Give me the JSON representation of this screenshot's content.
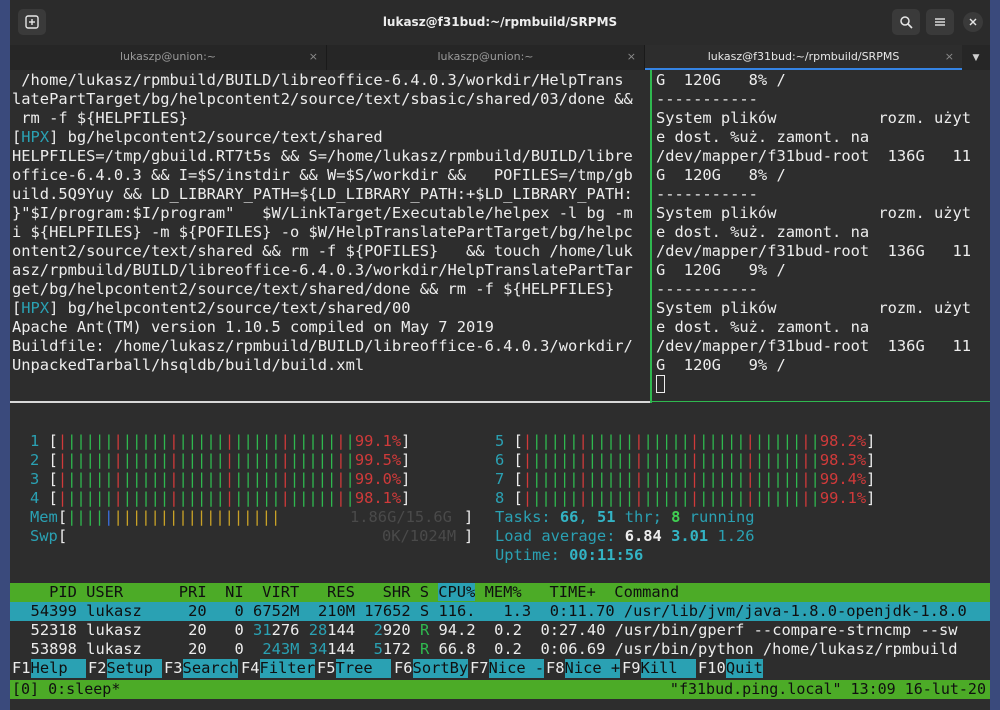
{
  "window": {
    "title": "lukasz@f31bud:~/rpmbuild/SRPMS",
    "new_tab_icon": "⊞",
    "search_icon": "🔍",
    "menu_icon": "≡",
    "close_icon": "✕"
  },
  "tabs": [
    {
      "label": "lukaszp@union:~",
      "close": "×"
    },
    {
      "label": "lukaszp@union:~",
      "close": "×"
    },
    {
      "label": "lukasz@f31bud:~/rpmbuild/SRPMS",
      "close": "×"
    }
  ],
  "tab_dropdown": "▼",
  "left_pane": {
    "l1": " /home/lukasz/rpmbuild/BUILD/libreoffice-6.4.0.3/workdir/HelpTrans",
    "l2": "latePartTarget/bg/helpcontent2/source/text/sbasic/shared/03/done &&",
    "l3": " rm -f ${HELPFILES}",
    "l4_tag": "HPX",
    "l4_rest": " bg/helpcontent2/source/text/shared",
    "l5": "HELPFILES=/tmp/gbuild.RT7t5s && S=/home/lukasz/rpmbuild/BUILD/libre",
    "l6": "office-6.4.0.3 && I=$S/instdir && W=$S/workdir &&   POFILES=/tmp/gb",
    "l7": "uild.5Q9Yuy && LD_LIBRARY_PATH=${LD_LIBRARY_PATH:+$LD_LIBRARY_PATH:",
    "l8": "}\"$I/program:$I/program\"   $W/LinkTarget/Executable/helpex -l bg -m",
    "l9": "i ${HELPFILES} -m ${POFILES} -o $W/HelpTranslatePartTarget/bg/helpc",
    "l10": "ontent2/source/text/shared && rm -f ${POFILES}   && touch /home/luk",
    "l11": "asz/rpmbuild/BUILD/libreoffice-6.4.0.3/workdir/HelpTranslatePartTar",
    "l12": "get/bg/helpcontent2/source/text/shared/done && rm -f ${HELPFILES}",
    "l13_tag": "HPX",
    "l13_rest": " bg/helpcontent2/source/text/shared/00",
    "l14": "Apache Ant(TM) version 1.10.5 compiled on May 7 2019",
    "l15": "Buildfile: /home/lukasz/rpmbuild/BUILD/libreoffice-6.4.0.3/workdir/",
    "l16": "UnpackedTarball/hsqldb/build/build.xml"
  },
  "right_pane": [
    "G  120G   8% /",
    "-----------",
    "System plików           rozm. użyt",
    "e dost. %uż. zamont. na",
    "/dev/mapper/f31bud-root  136G   11",
    "G  120G   8% /",
    "-----------",
    "System plików           rozm. użyt",
    "e dost. %uż. zamont. na",
    "/dev/mapper/f31bud-root  136G   11",
    "G  120G   9% /",
    "-----------",
    "System plików           rozm. użyt",
    "e dost. %uż. zamont. na",
    "/dev/mapper/f31bud-root  136G   11",
    "G  120G   9% /"
  ],
  "htop": {
    "cpus": [
      {
        "id": "1",
        "pct": "99.1%",
        "usage": 0.991
      },
      {
        "id": "2",
        "pct": "99.5%",
        "usage": 0.995
      },
      {
        "id": "3",
        "pct": "99.0%",
        "usage": 0.99
      },
      {
        "id": "4",
        "pct": "98.1%",
        "usage": 0.981
      },
      {
        "id": "5",
        "pct": "98.2%",
        "usage": 0.982
      },
      {
        "id": "6",
        "pct": "98.3%",
        "usage": 0.983
      },
      {
        "id": "7",
        "pct": "99.4%",
        "usage": 0.994
      },
      {
        "id": "8",
        "pct": "99.1%",
        "usage": 0.991
      }
    ],
    "mem_label": "Mem",
    "mem_value": "1.86G/15.6G",
    "swp_label": "Swp",
    "swp_value": "0K/1024M",
    "tasks_label": "Tasks: ",
    "tasks_count": "66",
    "threads": "51",
    "thr_label": " thr; ",
    "running": "8",
    "running_label": " running",
    "load_label": "Load average: ",
    "load1": "6.84",
    "load5": "3.01",
    "load15": "1.26",
    "uptime_label": "Uptime: ",
    "uptime": "00:11:56",
    "header": "    PID USER      PRI  NI  VIRT   RES   SHR S ",
    "header_cpu": "CPU%",
    "header_rest": " MEM%   TIME+  Command",
    "processes": [
      {
        "pid": "54399",
        "user": "lukasz",
        "pri": "20",
        "ni": "0",
        "virt": "6752M",
        "res": "210M",
        "shr": "17652",
        "s": "S",
        "cpu": "116.",
        "mem": "1.3",
        "time": "0:11.70",
        "cmd": "/usr/lib/jvm/java-1.8.0-openjdk-1.8.0"
      },
      {
        "pid": "52318",
        "user": "lukasz",
        "pri": "20",
        "ni": "0",
        "virt_a": "31",
        "virt_b": "276",
        "res_a": "28",
        "res_b": "144",
        "shr_a": "2",
        "shr_b": "920",
        "s": "R",
        "cpu": "94.2",
        "mem": "0.2",
        "time": "0:27.40",
        "cmd": "/usr/bin/gperf --compare-strncmp --sw"
      },
      {
        "pid": "53898",
        "user": "lukasz",
        "pri": "20",
        "ni": "0",
        "virt_a": "243M",
        "res_a": "34",
        "res_b": "144",
        "shr_a": "5",
        "shr_b": "172",
        "s": "R",
        "cpu": "66.8",
        "mem": "0.2",
        "time": "0:06.69",
        "cmd": "/usr/bin/python /home/lukasz/rpmbuild"
      }
    ],
    "fkeys": [
      {
        "key": "F1",
        "label": "Help  "
      },
      {
        "key": "F2",
        "label": "Setup "
      },
      {
        "key": "F3",
        "label": "Search"
      },
      {
        "key": "F4",
        "label": "Filter"
      },
      {
        "key": "F5",
        "label": "Tree  "
      },
      {
        "key": "F6",
        "label": "SortBy"
      },
      {
        "key": "F7",
        "label": "Nice -"
      },
      {
        "key": "F8",
        "label": "Nice +"
      },
      {
        "key": "F9",
        "label": "Kill  "
      },
      {
        "key": "F10",
        "label": "Quit"
      }
    ]
  },
  "tmux": {
    "left": "[0] 0:sleep*",
    "right": "\"f31bud.ping.local\" 13:09 16-lut-20"
  }
}
